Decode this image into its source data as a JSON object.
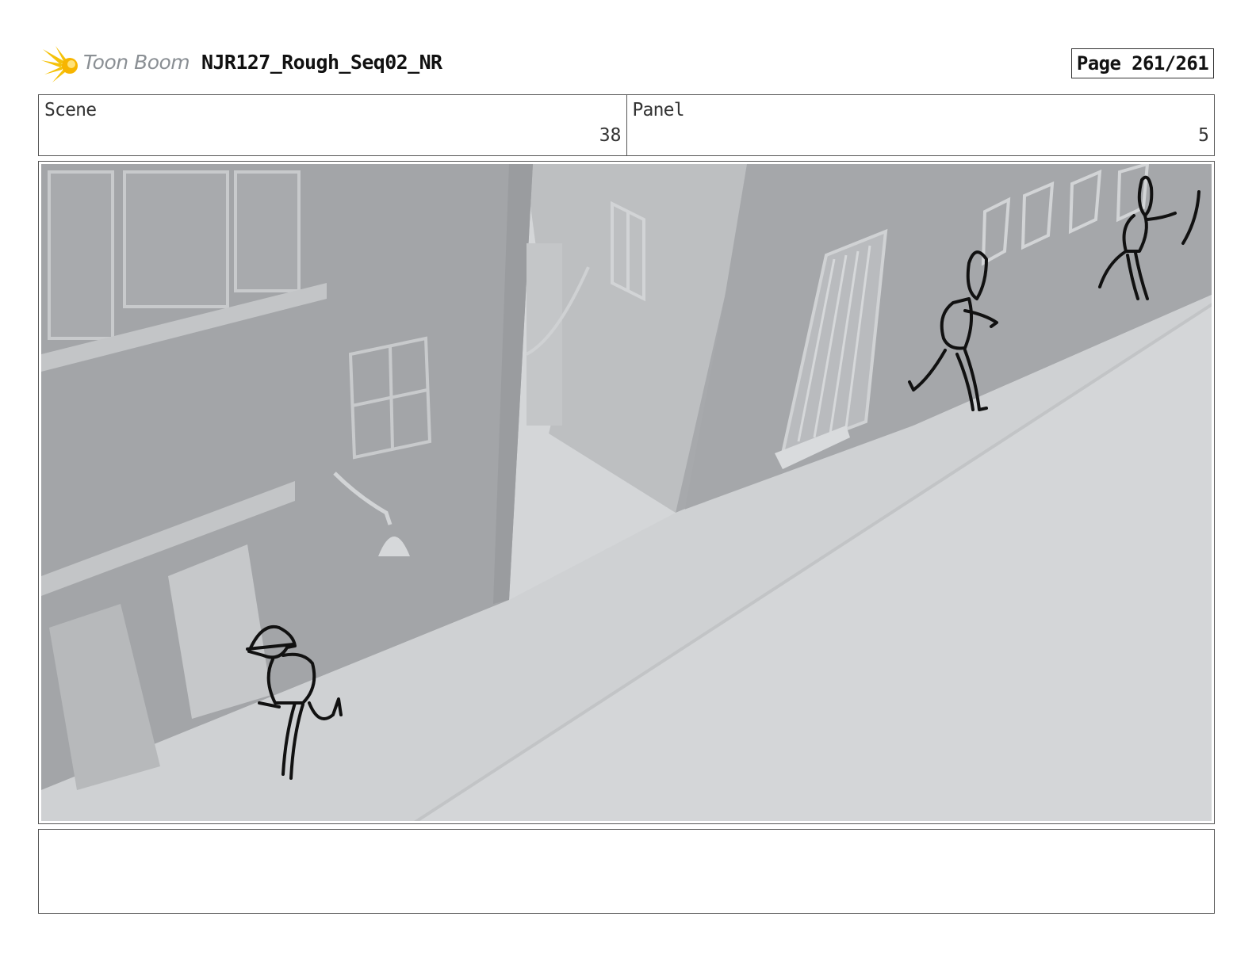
{
  "header": {
    "logo_text": "Toon Boom",
    "project_title": "NJR127_Rough_Seq02_NR",
    "page_label": "Page 261/261"
  },
  "info": {
    "scene_label": "Scene",
    "scene_value": "38",
    "panel_label": "Panel",
    "panel_value": "5"
  },
  "notes": {
    "text": ""
  },
  "colors": {
    "logo_yellow": "#f5c20a",
    "logo_text": "#8a8f94",
    "street": "#d4d6d8",
    "building": "#a3a5a8",
    "sketch": "#111111"
  }
}
